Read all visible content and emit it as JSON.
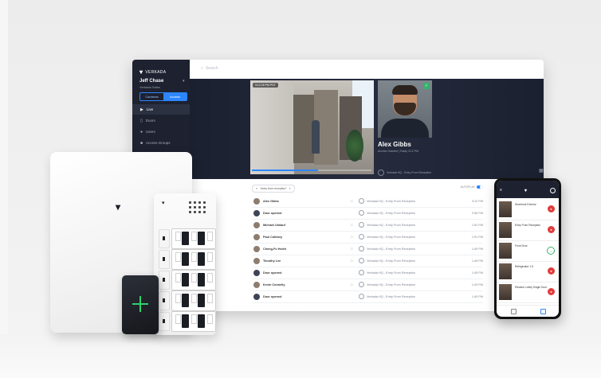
{
  "app": {
    "brand": "VERKADA",
    "search_placeholder": "Search",
    "user": {
      "name": "Jeff Chase",
      "org": "Verkada Sales"
    },
    "segment": [
      "Cameras",
      "Access"
    ],
    "nav": [
      {
        "label": "Live",
        "icon": "live-icon",
        "active": true
      },
      {
        "label": "Doors",
        "icon": "door-icon",
        "active": false
      },
      {
        "label": "Users",
        "icon": "users-icon",
        "active": false
      },
      {
        "label": "Access Groups",
        "icon": "group-icon",
        "active": false
      }
    ]
  },
  "live": {
    "timestamp": "3:12:26 PM PDT",
    "person_name": "Alex Gibbs",
    "person_status": "Access Granted  |  Today 3:12 PM",
    "entry_label": "Verkada HQ - Entry From Reception",
    "scrub_progress": 0.55
  },
  "feed": {
    "filter_chip": "\"entry from reception\"",
    "autoplay_label": "AUTOPLAY",
    "rows": [
      {
        "name": "Alex Gibbs",
        "avatar": "person",
        "cred": "□",
        "event": "Verkada HQ - Entry From Reception",
        "time": "3:12 PM"
      },
      {
        "name": "Door opened",
        "avatar": "door",
        "cred": "",
        "event": "Verkada HQ - Entry From Reception",
        "time": "2:55 PM"
      },
      {
        "name": "Michael Umlauf",
        "avatar": "person",
        "cred": "□",
        "event": "Verkada HQ - Entry From Reception",
        "time": "1:52 PM"
      },
      {
        "name": "Paul Colleary",
        "avatar": "person",
        "cred": "□",
        "event": "Verkada HQ - Entry From Reception",
        "time": "1:51 PM"
      },
      {
        "name": "Cheng-Fu Hsieh",
        "avatar": "person",
        "cred": "□",
        "event": "Verkada HQ - Entry From Reception",
        "time": "1:49 PM"
      },
      {
        "name": "Timothy Lee",
        "avatar": "person",
        "cred": "□",
        "event": "Verkada HQ - Entry From Reception",
        "time": "1:46 PM"
      },
      {
        "name": "Door opened",
        "avatar": "door",
        "cred": "",
        "event": "Verkada HQ - Entry From Reception",
        "time": "1:45 PM"
      },
      {
        "name": "Kevin Connelly",
        "avatar": "person",
        "cred": "□",
        "event": "Verkada HQ - Entry From Reception",
        "time": "1:43 PM"
      },
      {
        "name": "Door opened",
        "avatar": "door",
        "cred": "",
        "event": "Verkada HQ - Entry From Reception",
        "time": "1:40 PM"
      }
    ]
  },
  "phone": {
    "doors": [
      {
        "label": "Storefront Exterior",
        "state": "locked"
      },
      {
        "label": "Entry From Reception",
        "state": "locked"
      },
      {
        "label": "Front Door",
        "state": "unlocked"
      },
      {
        "label": "Refrigerator 1.5",
        "state": "locked"
      },
      {
        "label": "Elevator Lobby Single Door",
        "state": "locked"
      }
    ]
  },
  "colors": {
    "accent": "#2d86ff",
    "granted": "#35b36b",
    "locked": "#e23c3c",
    "sidebar": "#1d2130"
  }
}
